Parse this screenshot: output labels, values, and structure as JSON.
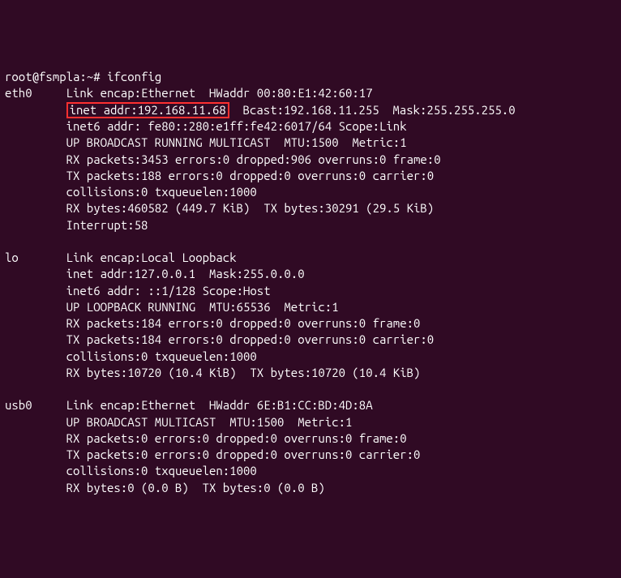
{
  "prompt": {
    "user_host": "root@fsmpla",
    "path": "~",
    "separator1": ":",
    "separator2": "#",
    "command": "ifconfig"
  },
  "eth0": {
    "name": "eth0",
    "l1": "Link encap:Ethernet  HWaddr 00:80:E1:42:60:17",
    "l2a": "inet addr:192.168.11.68",
    "l2b": "  Bcast:192.168.11.255  Mask:255.255.255.0",
    "l3": "inet6 addr: fe80::280:e1ff:fe42:6017/64 Scope:Link",
    "l4": "UP BROADCAST RUNNING MULTICAST  MTU:1500  Metric:1",
    "l5": "RX packets:3453 errors:0 dropped:906 overruns:0 frame:0",
    "l6": "TX packets:188 errors:0 dropped:0 overruns:0 carrier:0",
    "l7": "collisions:0 txqueuelen:1000",
    "l8": "RX bytes:460582 (449.7 KiB)  TX bytes:30291 (29.5 KiB)",
    "l9": "Interrupt:58"
  },
  "lo": {
    "name": "lo",
    "l1": "Link encap:Local Loopback",
    "l2": "inet addr:127.0.0.1  Mask:255.0.0.0",
    "l3": "inet6 addr: ::1/128 Scope:Host",
    "l4": "UP LOOPBACK RUNNING  MTU:65536  Metric:1",
    "l5": "RX packets:184 errors:0 dropped:0 overruns:0 frame:0",
    "l6": "TX packets:184 errors:0 dropped:0 overruns:0 carrier:0",
    "l7": "collisions:0 txqueuelen:1000",
    "l8": "RX bytes:10720 (10.4 KiB)  TX bytes:10720 (10.4 KiB)"
  },
  "usb0": {
    "name": "usb0",
    "l1": "Link encap:Ethernet  HWaddr 6E:B1:CC:BD:4D:8A",
    "l2": "UP BROADCAST MULTICAST  MTU:1500  Metric:1",
    "l3": "RX packets:0 errors:0 dropped:0 overruns:0 frame:0",
    "l4": "TX packets:0 errors:0 dropped:0 overruns:0 carrier:0",
    "l5": "collisions:0 txqueuelen:1000",
    "l6": "RX bytes:0 (0.0 B)  TX bytes:0 (0.0 B)"
  }
}
